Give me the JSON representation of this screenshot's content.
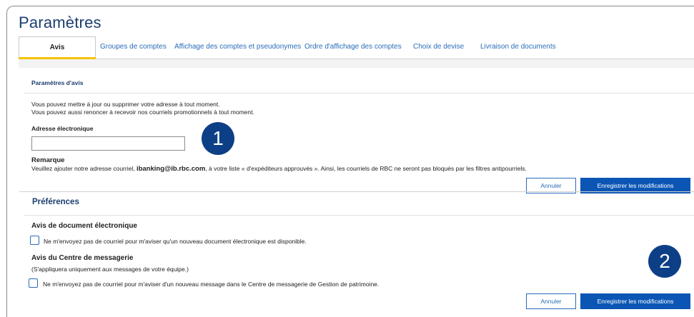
{
  "page_title": "Paramètres",
  "tabs": [
    {
      "label": "Avis"
    },
    {
      "label": "Groupes de comptes"
    },
    {
      "label": "Affichage des comptes et pseudonymes"
    },
    {
      "label": "Ordre d'affichage des comptes"
    },
    {
      "label": "Choix de devise"
    },
    {
      "label": "Livraison de documents"
    }
  ],
  "notifications": {
    "section_title": "Paramètres d'avis",
    "intro_line1": "Vous pouvez mettre à jour ou supprimer votre adresse à tout moment.",
    "intro_line2": "Vous pouvez aussi renoncer à recevoir nos courriels promotionnels à tout moment.",
    "email_label": "Adresse électronique",
    "email_value": "",
    "note_label": "Remarque",
    "note_before": "Veuillez ajouter notre adresse courriel, ",
    "note_email": "ibanking@ib.rbc.com",
    "note_after": ", à votre liste « d'expéditeurs approuvés ». Ainsi, les courriels de RBC ne seront pas bloqués par les filtres antipourriels.",
    "cancel_label": "Annuler",
    "save_label": "Enregistrer les modifications"
  },
  "preferences": {
    "title": "Préférences",
    "edoc_title": "Avis de document électronique",
    "edoc_checkbox_label": "Ne m'envoyez pas de courriel pour m'aviser qu'un nouveau document électronique est disponible.",
    "edoc_checked": false,
    "msg_title": "Avis du Centre de messagerie",
    "msg_subtitle": "(S'appliquera uniquement aux messages de votre équipe.)",
    "msg_checkbox_label": "Ne m'envoyez pas de courriel pour m'aviser d'un nouveau message dans le Centre de messagerie de Gestion de patrimoine.",
    "msg_checked": false,
    "cancel_label": "Annuler",
    "save_label": "Enregistrer les modifications"
  },
  "callouts": {
    "badge1": "1",
    "badge2": "2"
  },
  "colors": {
    "brand_blue": "#0d3f86",
    "link_blue": "#2a6cb8",
    "primary_button": "#0b56b5",
    "active_tab_underline": "#f7c200"
  }
}
